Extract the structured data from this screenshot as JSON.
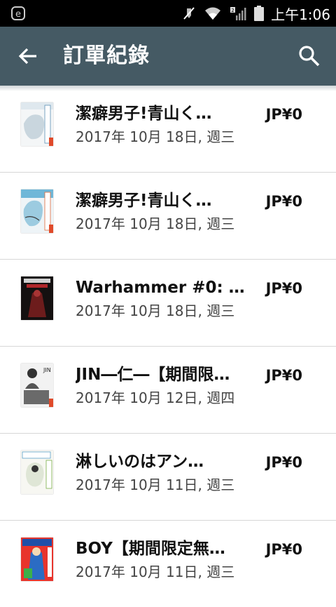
{
  "status_bar": {
    "time": "上午1:06",
    "icons": [
      "e-app-icon",
      "mute-icon",
      "wifi-icon",
      "signal-icon",
      "battery-icon"
    ]
  },
  "app_bar": {
    "title": "訂單紀錄",
    "back_icon": "back-arrow-icon",
    "search_icon": "search-icon",
    "background": "#455a64"
  },
  "orders": [
    {
      "title": "潔癖男子!青山く…",
      "date": "2017年 10月 18日, 週三",
      "price": "JP¥0"
    },
    {
      "title": "潔癖男子!青山く…",
      "date": "2017年 10月 18日, 週三",
      "price": "JP¥0"
    },
    {
      "title": "Warhammer #0: …",
      "date": "2017年 10月 18日, 週三",
      "price": "JP¥0"
    },
    {
      "title": "JIN―仁―【期間限…",
      "date": "2017年 10月 12日, 週四",
      "price": "JP¥0"
    },
    {
      "title": "淋しいのはアン…",
      "date": "2017年 10月 11日, 週三",
      "price": "JP¥0"
    },
    {
      "title": "BOY【期間限定無…",
      "date": "2017年 10月 11日, 週三",
      "price": "JP¥0"
    }
  ]
}
